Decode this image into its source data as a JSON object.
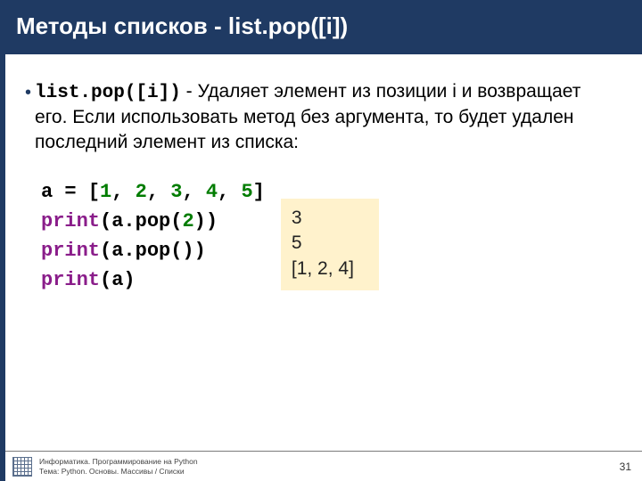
{
  "title": "Методы списков - list.pop([i])",
  "bullet": {
    "method": "list.pop([i])",
    "desc": " - Удаляет элемент из позиции i и возвращает его. Если использовать метод без аргумента, то будет удален последний элемент из списка:"
  },
  "code": {
    "l1_a": "a = [",
    "l1_n1": "1",
    "l1_c1": ", ",
    "l1_n2": "2",
    "l1_c2": ", ",
    "l1_n3": "3",
    "l1_c3": ", ",
    "l1_n4": "4",
    "l1_c4": ", ",
    "l1_n5": "5",
    "l1_b": "]",
    "l2_f": "print",
    "l2_a": "(a.pop(",
    "l2_n": "2",
    "l2_b": "))",
    "l3_f": "print",
    "l3_a": "(a.pop())",
    "l4_f": "print",
    "l4_a": "(a)"
  },
  "output": {
    "o1": "3",
    "o2": "5",
    "o3": "[1, 2, 4]"
  },
  "footer": {
    "line1": "Информатика. Программирование на Python",
    "line2": "Тема: Python. Основы. Массивы / Списки",
    "page": "31"
  }
}
